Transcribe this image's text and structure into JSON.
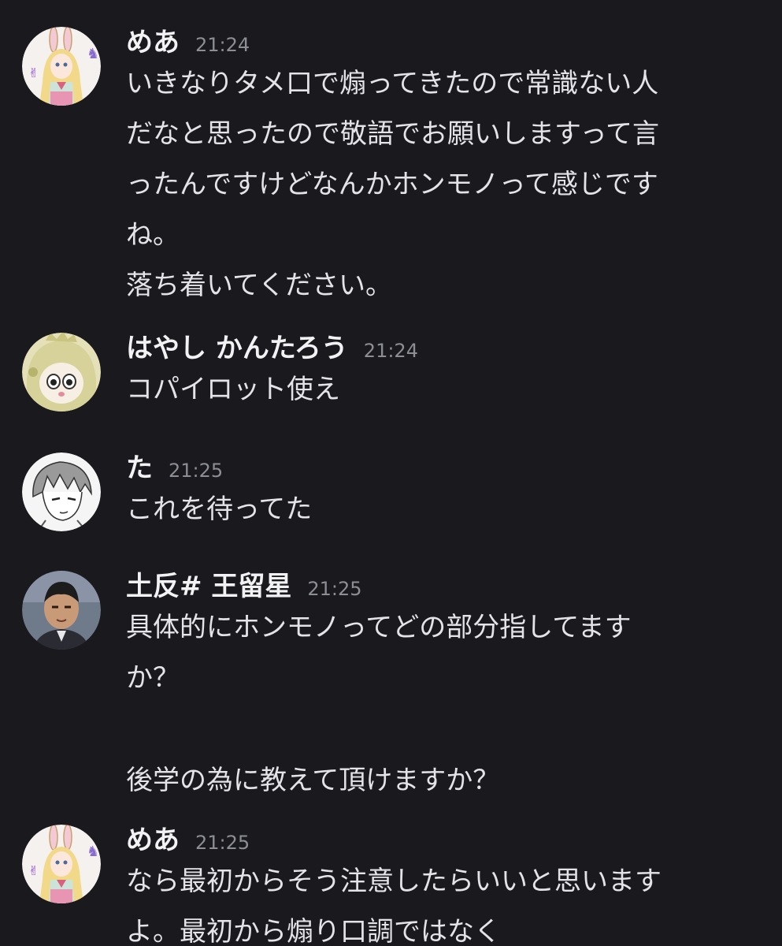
{
  "messages": [
    {
      "author": "めあ",
      "time": "21:24",
      "avatar_icon": "bunny-girl-avatar",
      "lines": [
        "いきなりタメ口で煽ってきたので常識ない人",
        "だなと思ったので敬語でお願いしますって言",
        "ったんですけどなんかホンモノって感じです",
        "ね。"
      ],
      "extra_lines": [
        "落ち着いてください。"
      ]
    },
    {
      "author": "はやし かんたろう",
      "time": "21:24",
      "avatar_icon": "dino-hood-avatar",
      "lines": [
        "コパイロット使え"
      ]
    },
    {
      "author": "た",
      "time": "21:25",
      "avatar_icon": "manga-boy-avatar",
      "lines": [
        "これを待ってた"
      ]
    },
    {
      "author": "土反# 王留星",
      "time": "21:25",
      "avatar_icon": "photo-man-avatar",
      "lines": [
        "具体的にホンモノってどの部分指してます",
        "か？"
      ],
      "extra_lines": [
        "後学の為に教えて頂けますか？"
      ]
    },
    {
      "author": "めあ",
      "time": "21:25",
      "avatar_icon": "bunny-girl-avatar",
      "lines": [
        "なら最初からそう注意したらいいと思います",
        "よ。最初から煽り口調ではなく"
      ]
    }
  ],
  "colors": {
    "background": "#1a1a1e",
    "name": "#f2f2f5",
    "time": "#8d8d94",
    "text": "#e4e4e8"
  }
}
